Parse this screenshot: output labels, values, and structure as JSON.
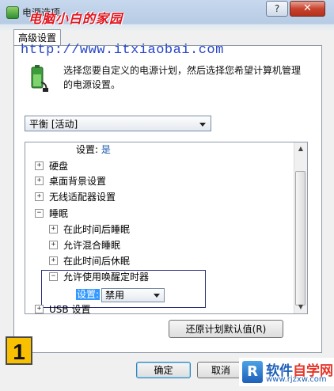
{
  "window": {
    "title": "电源选项",
    "watermark": "电脑小白的家园",
    "help_label": "?",
    "close_label": "✕"
  },
  "tabs": [
    {
      "label": "高级设置"
    }
  ],
  "url_overlay": "http://www.itxiaobai.com",
  "description": "选择您要自定义的电源计划，然后选择您希望计算机管理的电源设置。",
  "plan_select": {
    "value": "平衡 [活动]"
  },
  "tree": {
    "items": [
      {
        "label": "设置:",
        "value": "是"
      },
      {
        "expander": "+",
        "label": "硬盘"
      },
      {
        "expander": "+",
        "label": "桌面背景设置"
      },
      {
        "expander": "+",
        "label": "无线适配器设置"
      },
      {
        "expander": "−",
        "label": "睡眠"
      },
      {
        "expander": "+",
        "label": "在此时间后睡眠"
      },
      {
        "expander": "+",
        "label": "允许混合睡眠"
      },
      {
        "expander": "+",
        "label": "在此时间后休眠"
      },
      {
        "expander": "−",
        "label": "允许使用唤醒定时器"
      },
      {
        "label": "设置:",
        "select_value": "禁用"
      },
      {
        "expander": "+",
        "label": "USB 设置"
      }
    ]
  },
  "buttons": {
    "restore": "还原计划默认值(R)",
    "ok": "确定",
    "cancel": "取消"
  },
  "badge": "1",
  "site_logo": {
    "mark": "R",
    "text_blue": "软件",
    "text_red": "自学网",
    "url": "www.rjzxw.com"
  },
  "icons": {
    "battery": "battery-plug-icon",
    "scroll_up": "scroll-up-icon",
    "scroll_down": "scroll-down-icon"
  }
}
